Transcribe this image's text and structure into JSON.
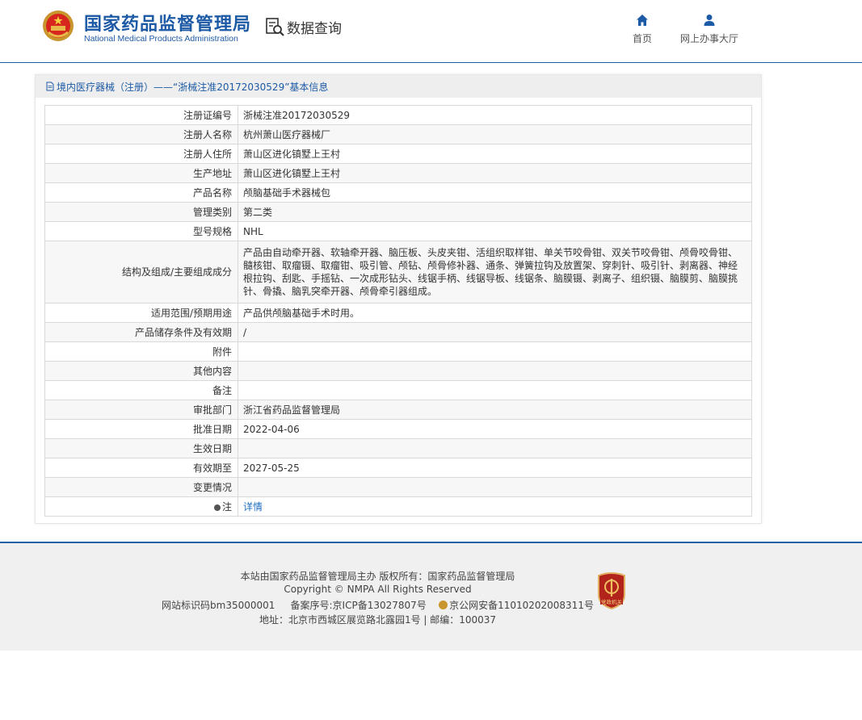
{
  "header": {
    "org_cn": "国家药品监督管理局",
    "org_en": "National Medical Products Administration",
    "query_label": "数据查询",
    "nav": [
      {
        "label": "首页",
        "icon": "home-icon"
      },
      {
        "label": "网上办事大厅",
        "icon": "user-icon"
      }
    ]
  },
  "panel": {
    "title": "境内医疗器械（注册）——“浙械注准20172030529”基本信息",
    "rows": [
      {
        "key": "注册证编号",
        "value": "浙械注准20172030529"
      },
      {
        "key": "注册人名称",
        "value": "杭州萧山医疗器械厂"
      },
      {
        "key": "注册人住所",
        "value": "萧山区进化镇墅上王村"
      },
      {
        "key": "生产地址",
        "value": "萧山区进化镇墅上王村"
      },
      {
        "key": "产品名称",
        "value": "颅脑基础手术器械包"
      },
      {
        "key": "管理类别",
        "value": "第二类"
      },
      {
        "key": "型号规格",
        "value": "NHL"
      },
      {
        "key": "结构及组成/主要组成成分",
        "value_lines": [
          "产品由自动牵开器、软轴牵开器、脑压板、头皮夹钳、活组织取样钳、单关节咬骨钳、双关节咬骨钳、颅骨咬骨钳、",
          "髓核钳、取瘤镊、取瘤钳、吸引管、颅钻、颅骨修补器、通条、弹簧拉钩及放置架、穿刺针、吸引针、剥离器、神经",
          "根拉钩、刮匙、手摇钻、一次成形钻头、线锯手柄、线锯导板、线锯条、脑膜镊、剥离子、组织镊、脑膜剪、脑膜挑",
          "针、骨撬、脑乳突牵开器、颅骨牵引器组成。"
        ]
      },
      {
        "key": "适用范围/预期用途",
        "value": "产品供颅脑基础手术时用。"
      },
      {
        "key": "产品储存条件及有效期",
        "value": "/"
      },
      {
        "key": "附件",
        "value": ""
      },
      {
        "key": "其他内容",
        "value": ""
      },
      {
        "key": "备注",
        "value": ""
      },
      {
        "key": "审批部门",
        "value": "浙江省药品监督管理局"
      },
      {
        "key": "批准日期",
        "value": "2022-04-06"
      },
      {
        "key": "生效日期",
        "value": ""
      },
      {
        "key": "有效期至",
        "value": "2027-05-25"
      },
      {
        "key": "变更情况",
        "value": ""
      }
    ],
    "note_key": "注",
    "note_link": "详情"
  },
  "footer": {
    "line1": "本站由国家药品监督管理局主办 版权所有：国家药品监督管理局",
    "line2": "Copyright © NMPA All Rights Reserved",
    "line3_id": "网站标识码bm35000001",
    "line3_icp": "备案序号:京ICP备13027807号",
    "line3_police": "京公网安备11010202008311号",
    "line4": "地址：北京市西城区展览路北露园1号 | 邮编：100037",
    "badge_text": "党政机关"
  }
}
